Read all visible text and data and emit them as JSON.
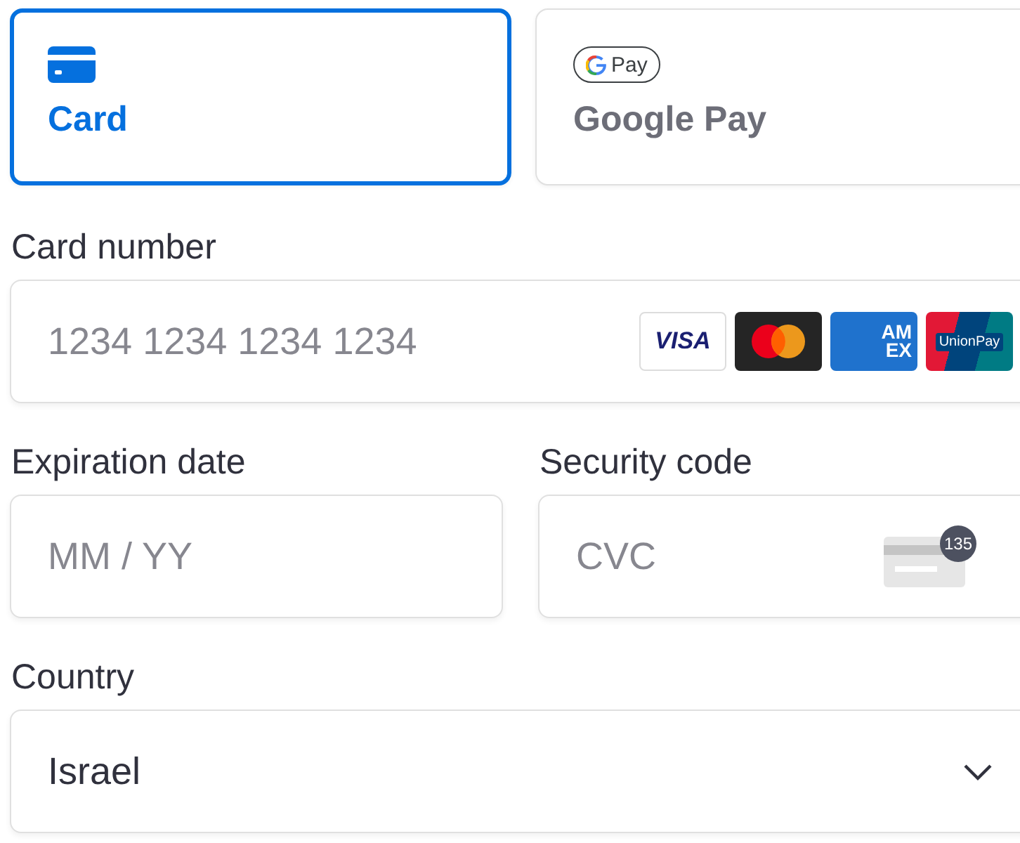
{
  "methods": [
    {
      "kind": "card",
      "label": "Card",
      "selected": true
    },
    {
      "kind": "gpay",
      "label": "Google Pay",
      "badge": "Pay",
      "selected": false
    }
  ],
  "card_number": {
    "label": "Card number",
    "placeholder": "1234 1234 1234 1234",
    "brands": [
      {
        "kind": "visa",
        "lines": [
          "VISA"
        ]
      },
      {
        "kind": "mastercard"
      },
      {
        "kind": "amex",
        "lines": [
          "AM",
          "EX"
        ]
      },
      {
        "kind": "unionpay",
        "lines": [
          "UnionPay"
        ]
      }
    ]
  },
  "expiration": {
    "label": "Expiration date",
    "placeholder": "MM / YY"
  },
  "security_code": {
    "label": "Security code",
    "placeholder": "CVC",
    "hint": "135"
  },
  "country": {
    "label": "Country",
    "value": "Israel"
  }
}
